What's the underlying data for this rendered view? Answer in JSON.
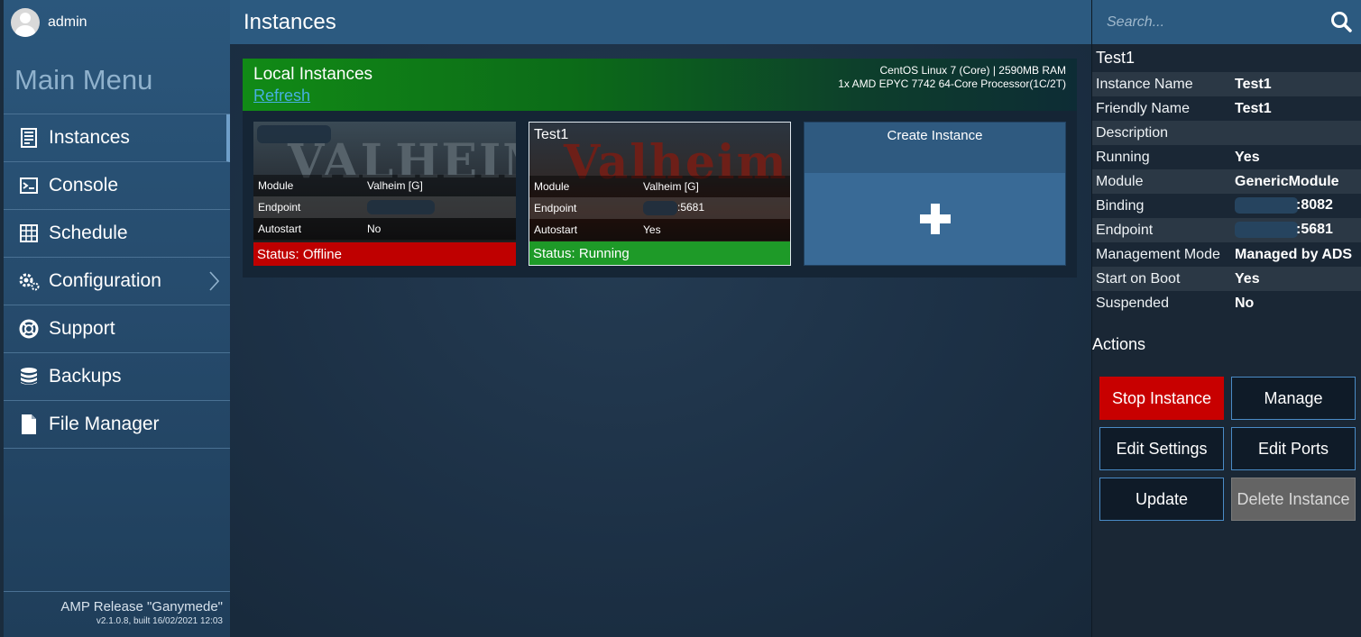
{
  "user": {
    "name": "admin"
  },
  "sidebar": {
    "title": "Main Menu",
    "items": [
      {
        "label": "Instances",
        "icon": "server-icon",
        "active": true
      },
      {
        "label": "Console",
        "icon": "console-icon"
      },
      {
        "label": "Schedule",
        "icon": "schedule-icon"
      },
      {
        "label": "Configuration",
        "icon": "gears-icon",
        "has_submenu": true
      },
      {
        "label": "Support",
        "icon": "lifebuoy-icon"
      },
      {
        "label": "Backups",
        "icon": "database-icon"
      },
      {
        "label": "File Manager",
        "icon": "file-icon"
      }
    ],
    "version_name": "AMP Release \"Ganymede\"",
    "version_build": "v2.1.0.8, built 16/02/2021 12:03"
  },
  "header": {
    "title": "Instances"
  },
  "panel": {
    "title": "Local Instances",
    "refresh_label": "Refresh",
    "sys_line1": "CentOS Linux 7 (Core) | 2590MB RAM",
    "sys_line2": "1x AMD EPYC 7742 64-Core Processor(1C/2T)"
  },
  "instances": [
    {
      "name": "",
      "art_text": "VALHEIM",
      "rows": [
        {
          "key": "Module",
          "value": "Valheim [G]"
        },
        {
          "key": "Endpoint",
          "value": ""
        },
        {
          "key": "Autostart",
          "value": "No"
        }
      ],
      "status": "Status: Offline"
    },
    {
      "name": "Test1",
      "art_text": "Valheim",
      "rows": [
        {
          "key": "Module",
          "value": "Valheim [G]"
        },
        {
          "key": "Endpoint",
          "value": ":5681"
        },
        {
          "key": "Autostart",
          "value": "Yes"
        }
      ],
      "status": "Status: Running"
    }
  ],
  "create_instance": {
    "label": "Create Instance"
  },
  "search": {
    "placeholder": "Search..."
  },
  "details": {
    "title": "Test1",
    "rows": [
      {
        "key": "Instance Name",
        "value": "Test1"
      },
      {
        "key": "Friendly Name",
        "value": "Test1"
      },
      {
        "key": "Description",
        "value": ""
      },
      {
        "key": "Running",
        "value": "Yes"
      },
      {
        "key": "Module",
        "value": "GenericModule"
      },
      {
        "key": "Binding",
        "value": ":8082"
      },
      {
        "key": "Endpoint",
        "value": ":5681"
      },
      {
        "key": "Management Mode",
        "value": "Managed by ADS"
      },
      {
        "key": "Start on Boot",
        "value": "Yes"
      },
      {
        "key": "Suspended",
        "value": "No"
      }
    ]
  },
  "actions": {
    "title": "Actions",
    "stop": "Stop Instance",
    "manage": "Manage",
    "edit_settings": "Edit Settings",
    "edit_ports": "Edit Ports",
    "update": "Update",
    "delete": "Delete Instance"
  },
  "colors": {
    "accent": "#2c5a80",
    "offline": "#bf0000",
    "running": "#1e9a28",
    "stop_button": "#c80000",
    "link": "#46b0e0"
  }
}
